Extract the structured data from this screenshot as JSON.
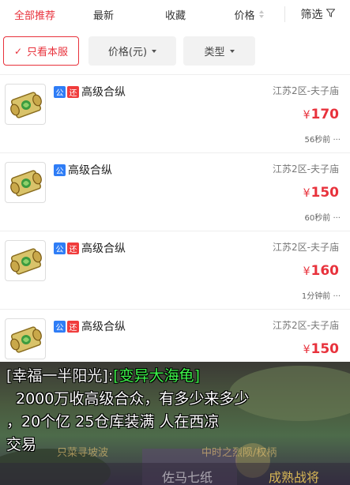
{
  "sort_tabs": {
    "recommended": "全部推荐",
    "latest": "最新",
    "favorites": "收藏",
    "price": "价格",
    "filter": "筛选"
  },
  "chips": {
    "own_server": "只看本服",
    "price": "价格(元)",
    "type": "类型"
  },
  "listings": [
    {
      "title": "高级合纵",
      "badges": [
        "公",
        "还"
      ],
      "server": "江苏2区-夫子庙",
      "price": "170",
      "currency": "¥",
      "time": "56秒前 ···"
    },
    {
      "title": "高级合纵",
      "badges": [
        "公"
      ],
      "server": "江苏2区-夫子庙",
      "price": "150",
      "currency": "¥",
      "time": "60秒前 ···"
    },
    {
      "title": "高级合纵",
      "badges": [
        "公",
        "还"
      ],
      "server": "江苏2区-夫子庙",
      "price": "160",
      "currency": "¥",
      "time": "1分钟前 ···"
    },
    {
      "title": "高级合纵",
      "badges": [
        "公",
        "还"
      ],
      "server": "江苏2区-夫子庙",
      "price": "150",
      "currency": "¥",
      "time": ""
    }
  ],
  "overlay": {
    "sender": "[幸福一半阳光]:",
    "target": "[变异大海龟]",
    "line1_rest": "",
    "message_line2": "2000万收高级合众，有多少来多少",
    "message_line3": "，20个亿  25仓库装满  人在西凉",
    "message_line4": "交易",
    "bg_left": "只菜寻坡波",
    "bg_right": "中时之烈陨/权柄",
    "bg_bottom1": "佐马七纸",
    "bg_bottom2": "成熟战将"
  },
  "colors": {
    "accent": "#e8323c",
    "badge_gong": "#2f7df6",
    "badge_huan": "#f03c3c",
    "chat_highlight": "#3df24a"
  }
}
